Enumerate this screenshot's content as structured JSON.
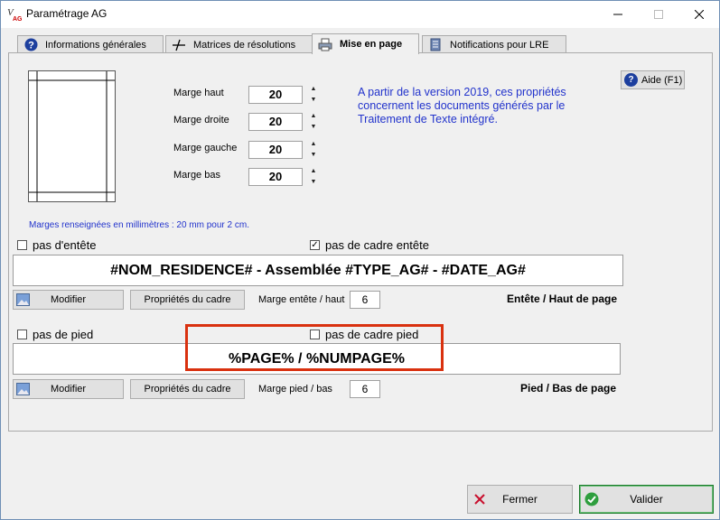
{
  "window": {
    "title": "Paramétrage AG",
    "controls": {
      "minimize": "—",
      "maximize": "☐",
      "close": "✕"
    }
  },
  "tabs": [
    {
      "label": "Informations générales",
      "icon": "question-icon"
    },
    {
      "label": "Matrices de résolutions",
      "icon": "pen-icon"
    },
    {
      "label": "Mise en page",
      "icon": "printer-icon",
      "active": true
    },
    {
      "label": "Notifications pour LRE",
      "icon": "document-icon"
    }
  ],
  "margins": {
    "haut": {
      "label": "Marge haut",
      "value": "20"
    },
    "droite": {
      "label": "Marge droite",
      "value": "20"
    },
    "gauche": {
      "label": "Marge gauche",
      "value": "20"
    },
    "bas": {
      "label": "Marge bas",
      "value": "20"
    },
    "spin_up": "▲",
    "spin_down": "▼"
  },
  "info_text": "A partir de la version 2019, ces propriétés concernent les documents générés par le Traitement de Texte intégré.",
  "help_button": {
    "label": "Aide (F1)",
    "icon": "question-icon",
    "glyph": "?"
  },
  "mm_note": "Marges renseignées en millimètres : 20 mm pour 2 cm.",
  "header": {
    "no_header": {
      "label": "pas d'entête",
      "checked": false
    },
    "no_frame": {
      "label": "pas de cadre entête",
      "checked": true,
      "check_glyph": "✓"
    },
    "content": "#NOM_RESIDENCE# - Assemblée #TYPE_AG# - #DATE_AG#",
    "modify_label": "Modifier",
    "frame_props_label": "Propriétés du cadre",
    "margin_label": "Marge entête / haut",
    "margin_value": "6",
    "section_title": "Entête / Haut de page"
  },
  "footer": {
    "no_footer": {
      "label": "pas de pied",
      "checked": false
    },
    "no_frame": {
      "label": "pas de cadre pied",
      "checked": false
    },
    "content": "%PAGE% / %NUMPAGE%",
    "modify_label": "Modifier",
    "frame_props_label": "Propriétés du cadre",
    "margin_label": "Marge pied / bas",
    "margin_value": "6",
    "section_title": "Pied / Bas de page"
  },
  "actions": {
    "cancel_label": "Fermer",
    "cancel_icon": "close-x-icon",
    "ok_label": "Valider",
    "ok_icon": "check-circle-icon"
  },
  "colors": {
    "info_blue": "#2233cc",
    "highlight_red": "#d9310f",
    "ok_green": "#1a7a2a"
  }
}
